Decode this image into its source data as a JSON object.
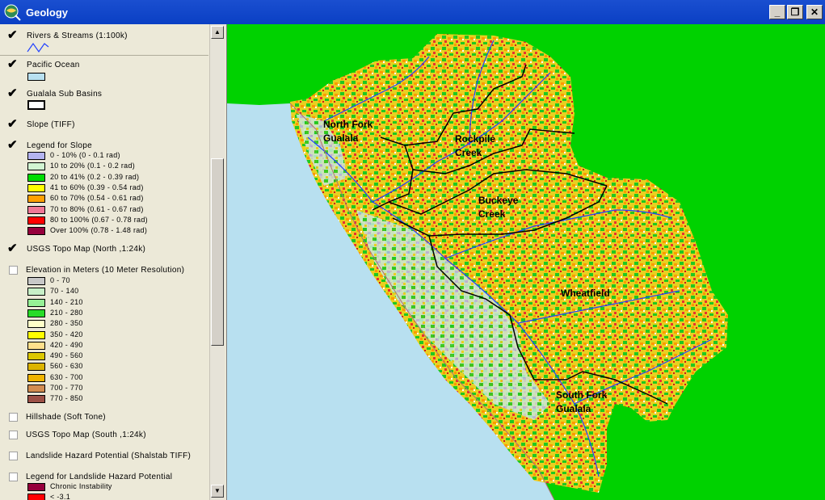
{
  "window": {
    "title": "Geology",
    "min": "_",
    "max": "❐",
    "close": "✕"
  },
  "toc": {
    "rivers": {
      "label": "Rivers & Streams (1:100k)",
      "checked": true
    },
    "ocean": {
      "label": "Pacific Ocean",
      "checked": true
    },
    "subbasins": {
      "label": "Gualala Sub Basins",
      "checked": true
    },
    "slope": {
      "label": "Slope (TIFF)",
      "checked": true
    },
    "slope_legend": {
      "label": "Legend for Slope",
      "checked": true,
      "items": [
        {
          "label": "0 - 10% (0 - 0.1 rad)",
          "color": "#b4b4f0"
        },
        {
          "label": "10 to 20% (0.1 - 0.2 rad)",
          "color": "#d2f5d2"
        },
        {
          "label": "20 to 41% (0.2 - 0.39 rad)",
          "color": "#00dc00"
        },
        {
          "label": "41 to 60% (0.39 - 0.54 rad)",
          "color": "#ffff00"
        },
        {
          "label": "60 to 70% (0.54 - 0.61 rad)",
          "color": "#ffa000"
        },
        {
          "label": "70 to 80% (0.61 - 0.67 rad)",
          "color": "#f07896"
        },
        {
          "label": "80 to 100% (0.67 - 0.78 rad)",
          "color": "#ff0000"
        },
        {
          "label": "Over 100% (0.78 - 1.48 rad)",
          "color": "#96003c"
        }
      ]
    },
    "topo_north": {
      "label": "USGS Topo Map (North ,1:24k)",
      "checked": true
    },
    "elevation": {
      "label": "Elevation in Meters (10 Meter Resolution)",
      "checked": false,
      "items": [
        {
          "label": "0 - 70",
          "color": "#c8c8c8"
        },
        {
          "label": "70 - 140",
          "color": "#c8f0c8"
        },
        {
          "label": "140 - 210",
          "color": "#96f096"
        },
        {
          "label": "210 - 280",
          "color": "#28dc28"
        },
        {
          "label": "280 - 350",
          "color": "#ffffc8"
        },
        {
          "label": "350 - 420",
          "color": "#ffff00"
        },
        {
          "label": "420 - 490",
          "color": "#ffe08c"
        },
        {
          "label": "490 - 560",
          "color": "#dcc800"
        },
        {
          "label": "560 - 630",
          "color": "#dcb400"
        },
        {
          "label": "630 - 700",
          "color": "#f0b400"
        },
        {
          "label": "700 - 770",
          "color": "#d28c50"
        },
        {
          "label": "770 - 850",
          "color": "#9c5046"
        }
      ]
    },
    "hillshade": {
      "label": "Hillshade (Soft Tone)",
      "checked": false
    },
    "topo_south": {
      "label": "USGS Topo Map (South ,1:24k)",
      "checked": false
    },
    "landslide": {
      "label": "Landslide Hazard Potential (Shalstab TIFF)",
      "checked": false
    },
    "landslide_legend": {
      "label": "Legend for Landslide Hazard Potential",
      "checked": false,
      "items": [
        {
          "label": "Chronic Instability",
          "color": "#96003c"
        },
        {
          "label": "< -3.1",
          "color": "#ff0000"
        }
      ]
    }
  },
  "map": {
    "labels": {
      "north_fork": [
        "North Fork",
        "Gualala"
      ],
      "rockpile": [
        "Rockpile",
        "Creek"
      ],
      "buckeye": [
        "Buckeye",
        "Creek"
      ],
      "wheatfield": [
        "Wheatfield"
      ],
      "south_fork": [
        "South Fork",
        "Gualala"
      ]
    },
    "colors": {
      "land": "#00d200",
      "ocean": "#b8e0f0",
      "river": "#2040ff"
    }
  }
}
